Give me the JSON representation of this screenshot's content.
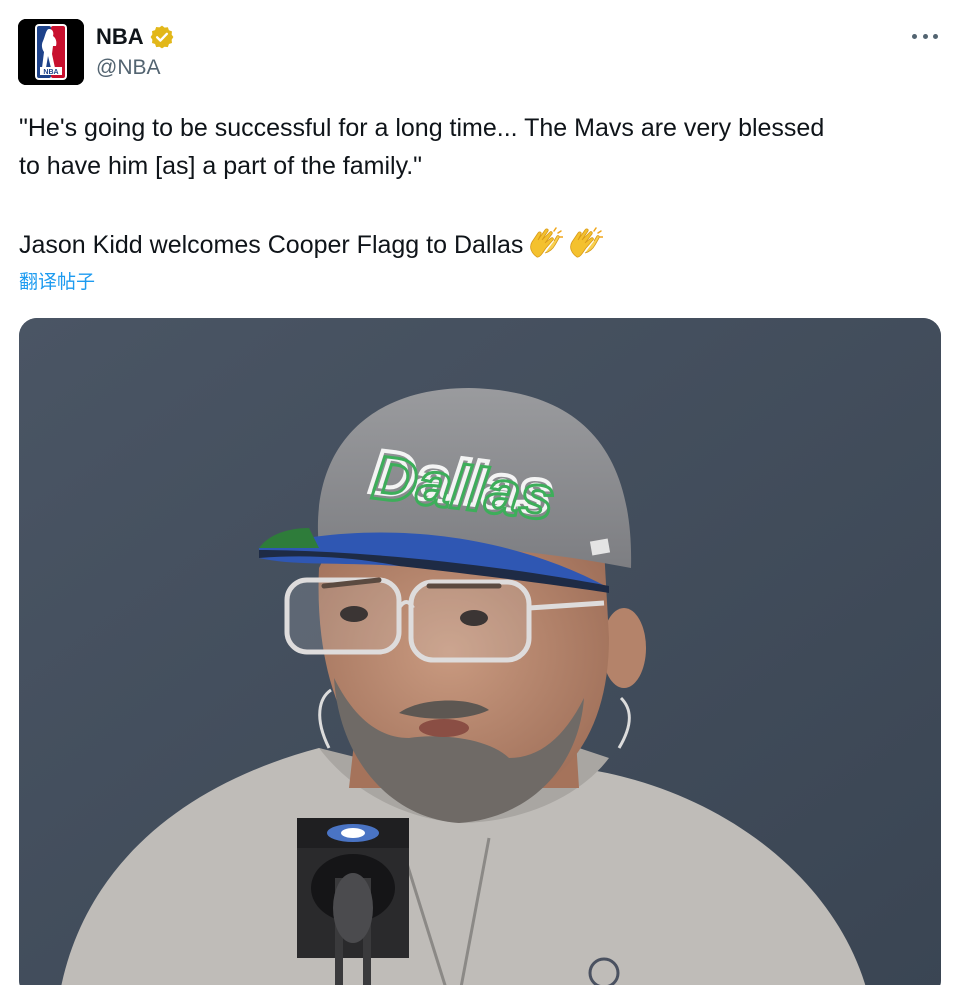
{
  "author": {
    "display_name": "NBA",
    "handle": "@NBA",
    "avatar_icon": "nba-logo-icon",
    "verified_icon": "verified-gold-badge-icon"
  },
  "menu": {
    "icon": "more-horizontal-icon"
  },
  "tweet": {
    "line1": "\"He's going to be successful for a long time... The Mavs are very blessed",
    "line2": "to have him [as] a part of the family.\"",
    "line3": "Jason Kidd welcomes Cooper Flagg to Dallas",
    "emojis": [
      "clapping-hands-emoji",
      "clapping-hands-emoji"
    ]
  },
  "translate_link": "翻译帖子",
  "media": {
    "cap_text": "Dallas"
  },
  "colors": {
    "link": "#1d9bf0",
    "text": "#0f1419",
    "secondary": "#536471",
    "verified_gold": "#e2b719"
  }
}
